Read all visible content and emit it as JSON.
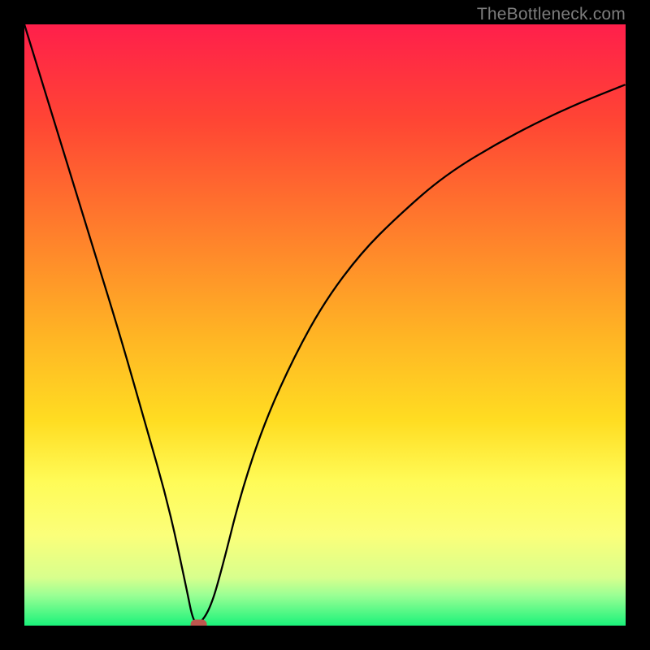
{
  "attribution": "TheBottleneck.com",
  "chart_data": {
    "type": "line",
    "title": "",
    "xlabel": "",
    "ylabel": "",
    "xlim": [
      0,
      100
    ],
    "ylim": [
      0,
      100
    ],
    "gradient_stops": [
      {
        "pct": 0,
        "color": "#ff1f4b"
      },
      {
        "pct": 16,
        "color": "#ff4534"
      },
      {
        "pct": 34,
        "color": "#ff7d2c"
      },
      {
        "pct": 52,
        "color": "#ffb524"
      },
      {
        "pct": 66,
        "color": "#ffdd22"
      },
      {
        "pct": 76,
        "color": "#fffb57"
      },
      {
        "pct": 85,
        "color": "#fbff7a"
      },
      {
        "pct": 92,
        "color": "#d8ff8d"
      },
      {
        "pct": 95,
        "color": "#99ff94"
      },
      {
        "pct": 100,
        "color": "#1af27a"
      }
    ],
    "series": [
      {
        "name": "bottleneck-curve",
        "x": [
          0,
          4,
          8,
          12,
          16,
          20,
          24,
          27,
          28,
          29,
          31,
          33,
          36,
          40,
          45,
          50,
          56,
          62,
          70,
          80,
          90,
          100
        ],
        "values": [
          100,
          87,
          74,
          61,
          48,
          34,
          20,
          6,
          1,
          0,
          3,
          10,
          22,
          34,
          45,
          54,
          62,
          68,
          75,
          81,
          86,
          90
        ]
      }
    ],
    "optimal_point": {
      "x": 29,
      "y": 0
    }
  }
}
